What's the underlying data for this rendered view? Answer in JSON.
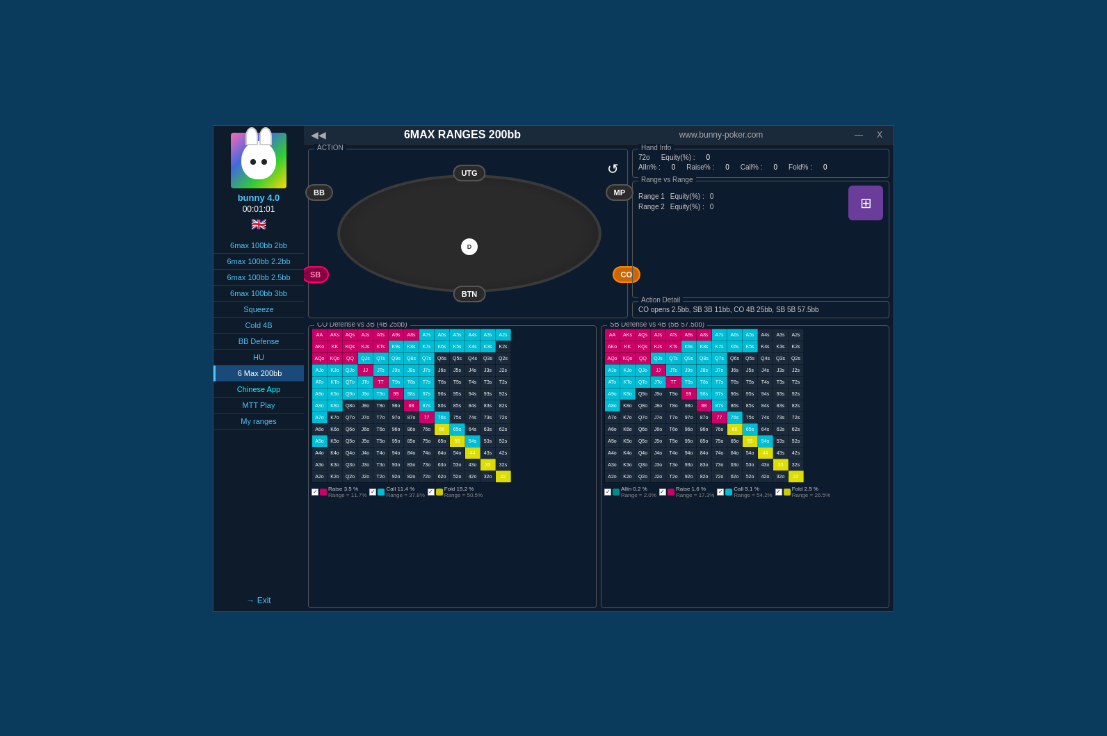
{
  "window": {
    "title": "6MAX RANGES 200bb",
    "url": "www.bunny-poker.com",
    "minimize": "—",
    "close": "X",
    "nav_back": "◀◀"
  },
  "sidebar": {
    "username": "bunny 4.0",
    "timer": "00:01:01",
    "flag": "🇬🇧",
    "items": [
      {
        "label": "6max 100bb 2bb",
        "active": false
      },
      {
        "label": "6max 100bb 2.2bb",
        "active": false
      },
      {
        "label": "6max 100bb 2.5bb",
        "active": false
      },
      {
        "label": "6max 100bb  3bb",
        "active": false
      },
      {
        "label": "Squeeze",
        "active": false
      },
      {
        "label": "Cold 4B",
        "active": false
      },
      {
        "label": "BB Defense",
        "active": false
      },
      {
        "label": "HU",
        "active": false
      },
      {
        "label": "6 Max 200bb",
        "active": true
      },
      {
        "label": "Chinese App",
        "active": false
      },
      {
        "label": "MTT Play",
        "active": false
      },
      {
        "label": "My ranges",
        "active": false
      }
    ],
    "exit_label": "→ Exit"
  },
  "action_panel_label": "ACTION",
  "positions": {
    "utg": "UTG",
    "mp": "MP",
    "co": "CO",
    "btn": "BTN",
    "sb": "SB",
    "bb": "BB",
    "dealer": "D"
  },
  "hand_info": {
    "label": "Hand Info",
    "hand": "72o",
    "equity_label": "Equity(%) :",
    "equity_val": "0",
    "allin_label": "AlIn% :",
    "allin_val": "0",
    "raise_label": "Raise% :",
    "raise_val": "0",
    "call_label": "Call% :",
    "call_val": "0",
    "fold_label": "Fold% :",
    "fold_val": "0"
  },
  "range_vs_range": {
    "label": "Range vs Range",
    "range1_label": "Range 1",
    "range1_equity": "Equity(%) :",
    "range1_val": "0",
    "range2_label": "Range 2",
    "range2_equity": "Equity(%) :",
    "range2_val": "0"
  },
  "action_detail": {
    "label": "Action Detail",
    "text": "CO opens 2.5bb, SB 3B 11bb, CO 4B 25bb, SB 5B 57.5bb"
  },
  "grid1": {
    "label": "CO Defense vs 3B  (4B 25bb)",
    "legend": [
      {
        "color": "#cc0066",
        "label": "Raise 3.5 %",
        "range": "Range = 11.7%"
      },
      {
        "color": "#00bcd4",
        "label": "Call 11.4 %",
        "range": "Range = 37.8%"
      },
      {
        "color": "#cccc00",
        "label": "Fold 15.2 %",
        "range": "Range = 50.5%"
      }
    ]
  },
  "grid2": {
    "label": "SB Defense vs 4B  (5B 57.5bb)",
    "legend": [
      {
        "color": "#008b8b",
        "label": "Allin 0.2 %",
        "range": "Range = 2.0%"
      },
      {
        "color": "#cc0066",
        "label": "Raise 1.6 %",
        "range": "Range = 17.3%"
      },
      {
        "color": "#00bcd4",
        "label": "Call 5.1 %",
        "range": "Range = 54.2%"
      },
      {
        "color": "#cccc00",
        "label": "Fold 2.5 %",
        "range": "Range = 26.5%"
      }
    ]
  },
  "grid_rows": [
    [
      "AA",
      "AKs",
      "AQs",
      "AJs",
      "ATs",
      "A9s",
      "A8s",
      "A7s",
      "A6s",
      "A5s",
      "A4s",
      "A3s",
      "A2s"
    ],
    [
      "AKo",
      "KK",
      "KQs",
      "KJs",
      "KTs",
      "K9s",
      "K8s",
      "K7s",
      "K6s",
      "K5s",
      "K4s",
      "K3s",
      "K2s"
    ],
    [
      "AQo",
      "KQo",
      "QQ",
      "QJs",
      "QTs",
      "Q9s",
      "Q8s",
      "Q7s",
      "Q6s",
      "Q5s",
      "Q4s",
      "Q3s",
      "Q2s"
    ],
    [
      "AJo",
      "KJo",
      "QJo",
      "JJ",
      "JTs",
      "J9s",
      "J8s",
      "J7s",
      "J6s",
      "J5s",
      "J4s",
      "J3s",
      "J2s"
    ],
    [
      "ATo",
      "KTo",
      "QTo",
      "JTo",
      "TT",
      "T9s",
      "T8s",
      "T7s",
      "T6s",
      "T5s",
      "T4s",
      "T3s",
      "T2s"
    ],
    [
      "A9o",
      "K9o",
      "Q9o",
      "J9o",
      "T9o",
      "99",
      "98s",
      "97s",
      "96s",
      "95s",
      "94s",
      "93s",
      "92s"
    ],
    [
      "A8o",
      "K8o",
      "Q8o",
      "J8o",
      "T8o",
      "98o",
      "88",
      "87s",
      "86s",
      "85s",
      "84s",
      "83s",
      "82s"
    ],
    [
      "A7o",
      "K7o",
      "Q7o",
      "J7o",
      "T7o",
      "97o",
      "87o",
      "77",
      "76s",
      "75s",
      "74s",
      "73s",
      "72s"
    ],
    [
      "A6o",
      "K6o",
      "Q6o",
      "J6o",
      "T6o",
      "96o",
      "86o",
      "76o",
      "66",
      "65s",
      "64s",
      "63s",
      "62s"
    ],
    [
      "A5o",
      "K5o",
      "Q5o",
      "J5o",
      "T5o",
      "95o",
      "85o",
      "75o",
      "65o",
      "55",
      "54s",
      "53s",
      "52s"
    ],
    [
      "A4o",
      "K4o",
      "Q4o",
      "J4o",
      "T4o",
      "94o",
      "84o",
      "74o",
      "64o",
      "54o",
      "44",
      "43s",
      "42s"
    ],
    [
      "A3o",
      "K3o",
      "Q3o",
      "J3o",
      "T3o",
      "93o",
      "83o",
      "73o",
      "63o",
      "53o",
      "43o",
      "33",
      "32s"
    ],
    [
      "A2o",
      "K2o",
      "Q2o",
      "J2o",
      "T2o",
      "92o",
      "82o",
      "72o",
      "62o",
      "52o",
      "42o",
      "32o",
      "22"
    ]
  ],
  "grid1_colors": [
    [
      "magenta",
      "magenta",
      "magenta",
      "magenta",
      "magenta",
      "magenta",
      "magenta",
      "cyan",
      "cyan",
      "cyan",
      "cyan",
      "cyan",
      "cyan"
    ],
    [
      "magenta",
      "magenta",
      "magenta",
      "magenta",
      "magenta",
      "cyan",
      "cyan",
      "cyan",
      "cyan",
      "cyan",
      "cyan",
      "cyan",
      "dark"
    ],
    [
      "magenta",
      "magenta",
      "magenta",
      "cyan",
      "cyan",
      "cyan",
      "cyan",
      "cyan",
      "dark",
      "dark",
      "dark",
      "dark",
      "dark"
    ],
    [
      "cyan",
      "cyan",
      "cyan",
      "magenta",
      "cyan",
      "cyan",
      "cyan",
      "cyan",
      "dark",
      "dark",
      "dark",
      "dark",
      "dark"
    ],
    [
      "cyan",
      "cyan",
      "cyan",
      "cyan",
      "magenta",
      "cyan",
      "cyan",
      "cyan",
      "dark",
      "dark",
      "dark",
      "dark",
      "dark"
    ],
    [
      "cyan",
      "cyan",
      "cyan",
      "cyan",
      "cyan",
      "magenta",
      "cyan",
      "cyan",
      "dark",
      "dark",
      "dark",
      "dark",
      "dark"
    ],
    [
      "cyan",
      "cyan",
      "dark",
      "dark",
      "dark",
      "dark",
      "magenta",
      "cyan",
      "dark",
      "dark",
      "dark",
      "dark",
      "dark"
    ],
    [
      "cyan",
      "dark",
      "dark",
      "dark",
      "dark",
      "dark",
      "dark",
      "magenta",
      "cyan",
      "dark",
      "dark",
      "dark",
      "dark"
    ],
    [
      "dark",
      "dark",
      "dark",
      "dark",
      "dark",
      "dark",
      "dark",
      "dark",
      "yellow",
      "cyan",
      "dark",
      "dark",
      "dark"
    ],
    [
      "cyan",
      "dark",
      "dark",
      "dark",
      "dark",
      "dark",
      "dark",
      "dark",
      "dark",
      "yellow",
      "cyan",
      "dark",
      "dark"
    ],
    [
      "dark",
      "dark",
      "dark",
      "dark",
      "dark",
      "dark",
      "dark",
      "dark",
      "dark",
      "dark",
      "yellow",
      "dark",
      "dark"
    ],
    [
      "dark",
      "dark",
      "dark",
      "dark",
      "dark",
      "dark",
      "dark",
      "dark",
      "dark",
      "dark",
      "dark",
      "yellow",
      "dark"
    ],
    [
      "dark",
      "dark",
      "dark",
      "dark",
      "dark",
      "dark",
      "dark",
      "dark",
      "dark",
      "dark",
      "dark",
      "dark",
      "yellow"
    ]
  ],
  "grid2_colors": [
    [
      "magenta",
      "magenta",
      "magenta",
      "magenta",
      "magenta",
      "magenta",
      "magenta",
      "cyan",
      "cyan",
      "cyan",
      "dark",
      "dark",
      "dark"
    ],
    [
      "magenta",
      "magenta",
      "magenta",
      "magenta",
      "magenta",
      "cyan",
      "cyan",
      "cyan",
      "cyan",
      "cyan",
      "dark",
      "dark",
      "dark"
    ],
    [
      "magenta",
      "magenta",
      "magenta",
      "cyan",
      "cyan",
      "cyan",
      "cyan",
      "cyan",
      "dark",
      "dark",
      "dark",
      "dark",
      "dark"
    ],
    [
      "cyan",
      "cyan",
      "cyan",
      "magenta",
      "cyan",
      "cyan",
      "cyan",
      "cyan",
      "dark",
      "dark",
      "dark",
      "dark",
      "dark"
    ],
    [
      "cyan",
      "cyan",
      "cyan",
      "cyan",
      "magenta",
      "cyan",
      "cyan",
      "cyan",
      "dark",
      "dark",
      "dark",
      "dark",
      "dark"
    ],
    [
      "cyan",
      "cyan",
      "dark",
      "dark",
      "dark",
      "magenta",
      "cyan",
      "cyan",
      "dark",
      "dark",
      "dark",
      "dark",
      "dark"
    ],
    [
      "cyan",
      "dark",
      "dark",
      "dark",
      "dark",
      "dark",
      "magenta",
      "cyan",
      "dark",
      "dark",
      "dark",
      "dark",
      "dark"
    ],
    [
      "dark",
      "dark",
      "dark",
      "dark",
      "dark",
      "dark",
      "dark",
      "magenta",
      "cyan",
      "dark",
      "dark",
      "dark",
      "dark"
    ],
    [
      "dark",
      "dark",
      "dark",
      "dark",
      "dark",
      "dark",
      "dark",
      "dark",
      "yellow",
      "cyan",
      "dark",
      "dark",
      "dark"
    ],
    [
      "dark",
      "dark",
      "dark",
      "dark",
      "dark",
      "dark",
      "dark",
      "dark",
      "dark",
      "yellow",
      "cyan",
      "dark",
      "dark"
    ],
    [
      "dark",
      "dark",
      "dark",
      "dark",
      "dark",
      "dark",
      "dark",
      "dark",
      "dark",
      "dark",
      "yellow",
      "dark",
      "dark"
    ],
    [
      "dark",
      "dark",
      "dark",
      "dark",
      "dark",
      "dark",
      "dark",
      "dark",
      "dark",
      "dark",
      "dark",
      "yellow",
      "dark"
    ],
    [
      "dark",
      "dark",
      "dark",
      "dark",
      "dark",
      "dark",
      "dark",
      "dark",
      "dark",
      "dark",
      "dark",
      "dark",
      "yellow"
    ]
  ]
}
